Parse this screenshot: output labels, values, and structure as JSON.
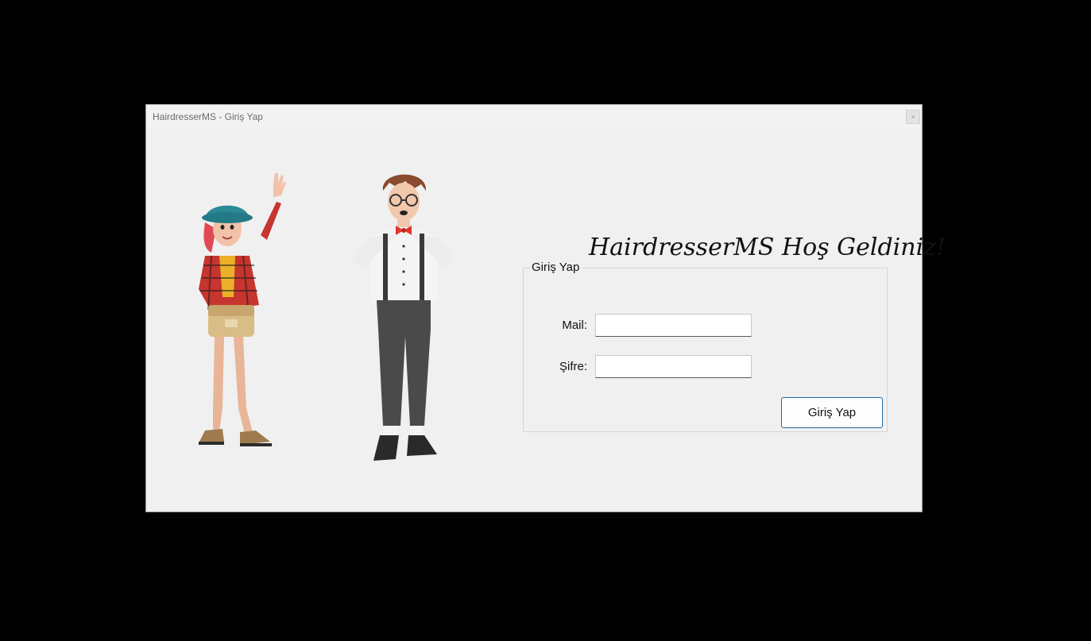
{
  "window": {
    "title": "HairdresserMS - Giriş Yap",
    "close_label": "×"
  },
  "illustrations": {
    "left": "woman-waving-illustration",
    "right": "man-bowtie-illustration"
  },
  "welcome_text": "HairdresserMS Hoş Geldiniz!",
  "login_group": {
    "legend": "Giriş Yap",
    "mail_label": "Mail:",
    "mail_value": "",
    "password_label": "Şifre:",
    "password_value": "",
    "submit_label": "Giriş Yap"
  },
  "colors": {
    "window_bg": "#f0f0f0",
    "button_border": "#1f6aa5",
    "screen_bg": "#000000"
  }
}
